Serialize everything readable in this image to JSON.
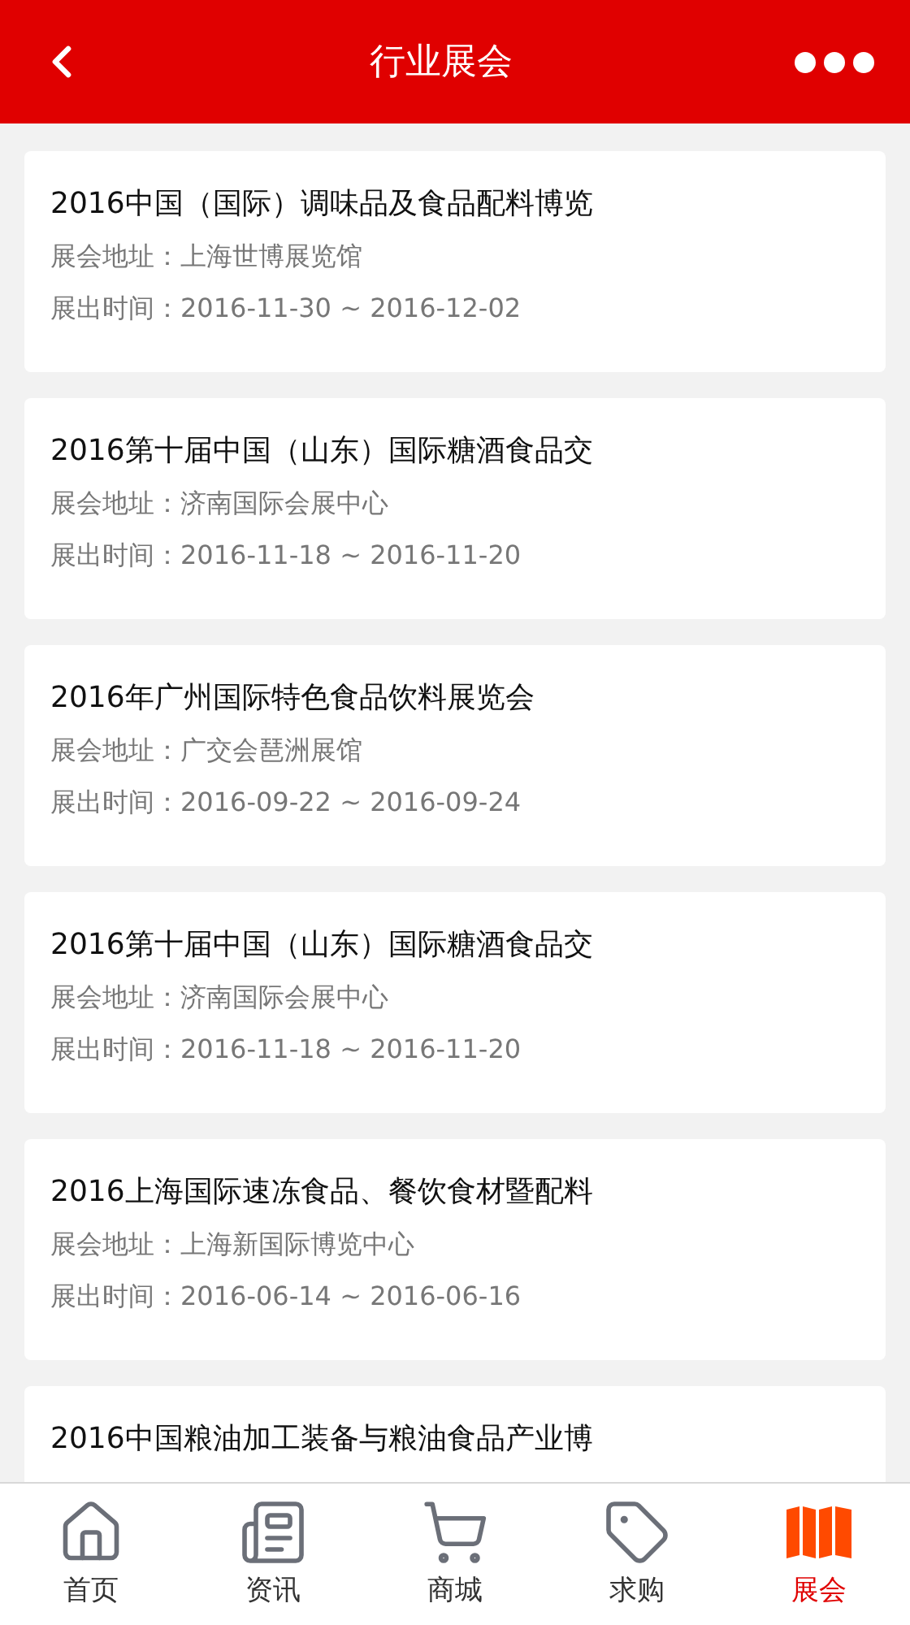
{
  "header": {
    "title": "行业展会"
  },
  "exhibitions": [
    {
      "title": "2016中国（国际）调味品及食品配料博览",
      "address": "展会地址：上海世博展览馆",
      "time": "展出时间：2016-11-30 ~ 2016-12-02"
    },
    {
      "title": "2016第十届中国（山东）国际糖酒食品交",
      "address": "展会地址：济南国际会展中心",
      "time": "展出时间：2016-11-18 ~ 2016-11-20"
    },
    {
      "title": "2016年广州国际特色食品饮料展览会",
      "address": "展会地址：广交会琶洲展馆",
      "time": "展出时间：2016-09-22 ~ 2016-09-24"
    },
    {
      "title": "2016第十届中国（山东）国际糖酒食品交",
      "address": "展会地址：济南国际会展中心",
      "time": "展出时间：2016-11-18 ~ 2016-11-20"
    },
    {
      "title": "2016上海国际速冻食品、餐饮食材暨配料",
      "address": "展会地址：上海新国际博览中心",
      "time": "展出时间：2016-06-14 ~ 2016-06-16"
    },
    {
      "title": "2016中国粮油加工装备与粮油食品产业博"
    }
  ],
  "bottom_nav": [
    {
      "kind": "home",
      "label": "首页",
      "selected": false
    },
    {
      "kind": "news",
      "label": "资讯",
      "selected": false
    },
    {
      "kind": "shop",
      "label": "商城",
      "selected": false
    },
    {
      "kind": "buy",
      "label": "求购",
      "selected": false
    },
    {
      "kind": "expo",
      "label": "展会",
      "selected": true
    }
  ]
}
